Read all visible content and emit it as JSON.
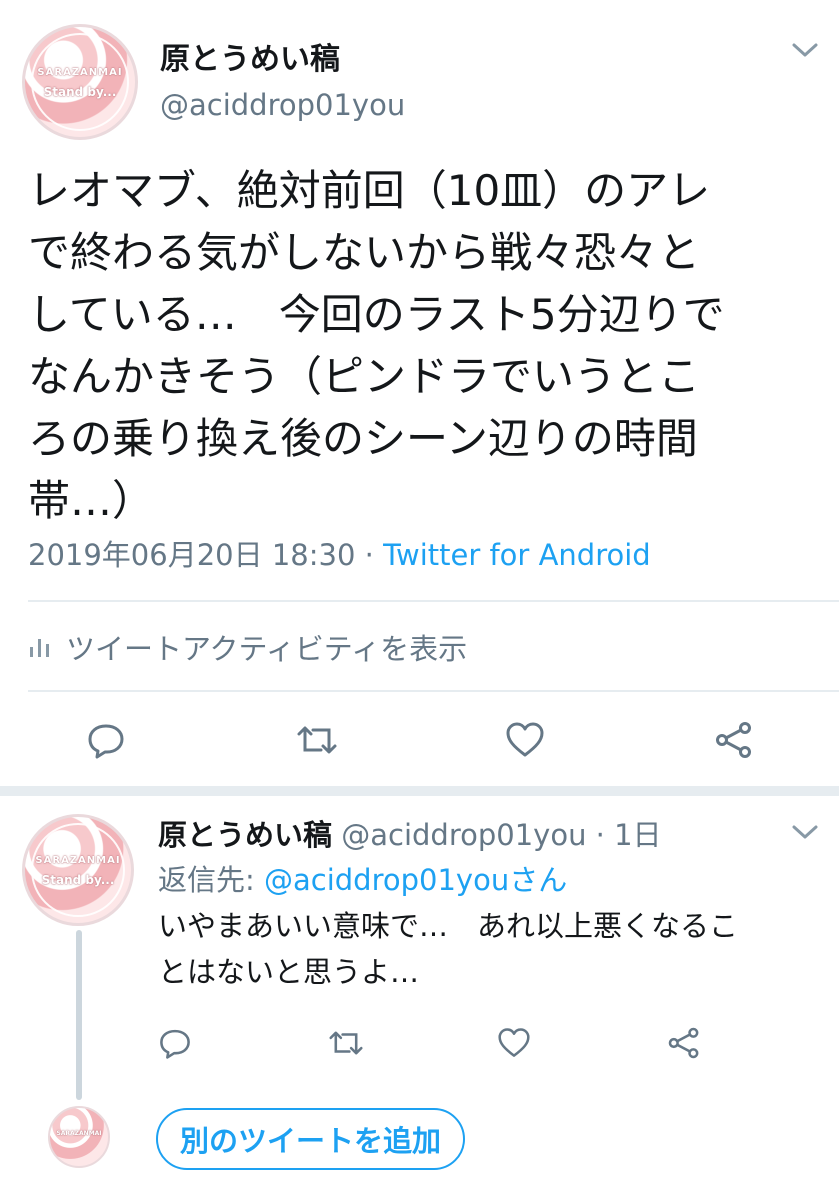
{
  "main_tweet": {
    "author_name": "原とうめい稿",
    "handle": "@aciddrop01you",
    "avatar_text_top": "SARAZANMAI",
    "avatar_text_bottom": "Stand by...",
    "text": "レオマブ、絶対前回（10皿）のアレ\nで終わる気がしないから戦々恐々と\nしている…　今回のラスト5分辺りで\nなんかきそう（ピンドラでいうとこ\nろの乗り換え後のシーン辺りの時間\n帯…）",
    "timestamp": "2019年06月20日 18:30",
    "separator": " · ",
    "source": "Twitter for Android",
    "activity_label": "ツイートアクティビティを表示"
  },
  "reply_tweet": {
    "author_name": "原とうめい稿",
    "handle": "@aciddrop01you",
    "age": " · 1日",
    "reply_to_label": "返信先: ",
    "reply_to_mention": "@aciddrop01youさん",
    "text": "いやまあいい意味で…　あれ以上悪くなるこ\nとはないと思うよ…",
    "avatar_text_top": "SARAZANMAI",
    "avatar_text_bottom": "Stand by..."
  },
  "compose": {
    "add_tweet_label": "別のツイートを追加",
    "avatar_text": "SARAZANMAI"
  },
  "colors": {
    "accent": "#1da1f2",
    "secondary_text": "#657786",
    "divider": "#e6ecf0",
    "icon": "#657786"
  },
  "icons": {
    "reply": "reply-icon",
    "retweet": "retweet-icon",
    "like": "heart-icon",
    "share": "share-icon",
    "menu": "chevron-down-icon",
    "activity": "bar-chart-icon"
  }
}
